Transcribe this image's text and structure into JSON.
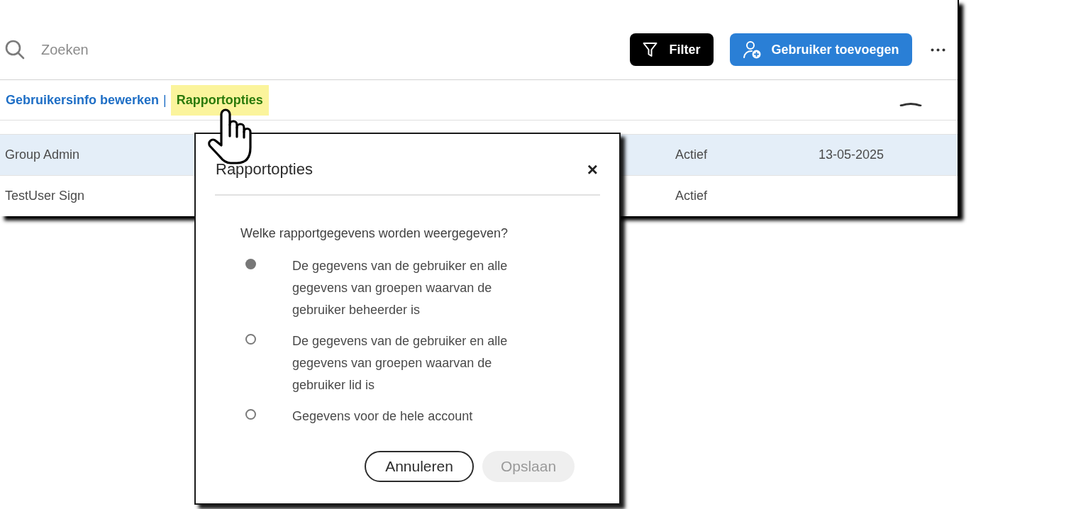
{
  "search": {
    "placeholder": "Zoeken"
  },
  "toolbar_buttons": [
    {
      "kind": "filter",
      "label": "Filter"
    },
    {
      "kind": "add_user",
      "label": "Gebruiker toevoegen"
    }
  ],
  "links": [
    {
      "label": "Gebruikersinfo bewerken",
      "highlighted": false
    },
    {
      "label": "Rapportopties",
      "highlighted": true
    }
  ],
  "link_separator": "|",
  "table": {
    "rows": [
      {
        "selected": true,
        "column_1": "Group Admin",
        "column_3": "Actief",
        "column_4": "13-05-2025"
      },
      {
        "selected": false,
        "column_1": "TestUser Sign",
        "column_3": "Actief"
      }
    ]
  },
  "dialog": {
    "title": "Rapportopties",
    "close": "×",
    "question": "Welke rapportgegevens worden weergegeven?",
    "options": [
      {
        "label": "De gegevens van de gebruiker en alle gegevens van groepen waarvan de gebruiker beheerder is",
        "selected": true
      },
      {
        "label": "De gegevens van de gebruiker en alle gegevens van groepen waarvan de gebruiker lid is",
        "selected": false
      },
      {
        "label": "Gegevens voor de hele account",
        "selected": false
      }
    ],
    "buttons": [
      {
        "kind": "secondary",
        "label": "Annuleren",
        "disabled": false
      },
      {
        "kind": "primary",
        "label": "Opslaan",
        "disabled": true
      }
    ]
  }
}
